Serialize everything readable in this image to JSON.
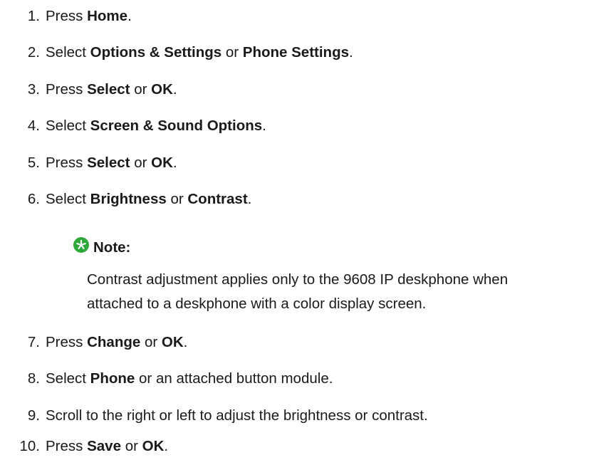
{
  "steps": [
    {
      "num": "1.",
      "parts": [
        "Press ",
        "Home",
        "."
      ]
    },
    {
      "num": "2.",
      "parts": [
        "Select ",
        "Options & Settings",
        " or ",
        "Phone Settings",
        "."
      ]
    },
    {
      "num": "3.",
      "parts": [
        "Press ",
        "Select",
        " or ",
        "OK",
        "."
      ]
    },
    {
      "num": "4.",
      "parts": [
        "Select ",
        "Screen & Sound Options",
        "."
      ]
    },
    {
      "num": "5.",
      "parts": [
        "Press ",
        "Select",
        " or ",
        "OK",
        "."
      ]
    },
    {
      "num": "6.",
      "parts": [
        "Select ",
        "Brightness",
        " or ",
        "Contrast",
        "."
      ]
    },
    {
      "num": "7.",
      "parts": [
        "Press ",
        "Change",
        " or ",
        "OK",
        "."
      ]
    },
    {
      "num": "8.",
      "parts": [
        "Select ",
        "Phone",
        " or an attached button module."
      ]
    },
    {
      "num": "9.",
      "parts": [
        "Scroll to the right or left to adjust the brightness or contrast."
      ]
    },
    {
      "num": "10.",
      "parts": [
        "Press ",
        "Save",
        " or ",
        "OK",
        "."
      ]
    }
  ],
  "note": {
    "icon": "star-icon",
    "icon_color": "#2fa83a",
    "title": "Note:",
    "line1": "Contrast adjustment applies only to the 9608 IP deskphone when",
    "line2": "attached to a deskphone with a color display screen."
  }
}
